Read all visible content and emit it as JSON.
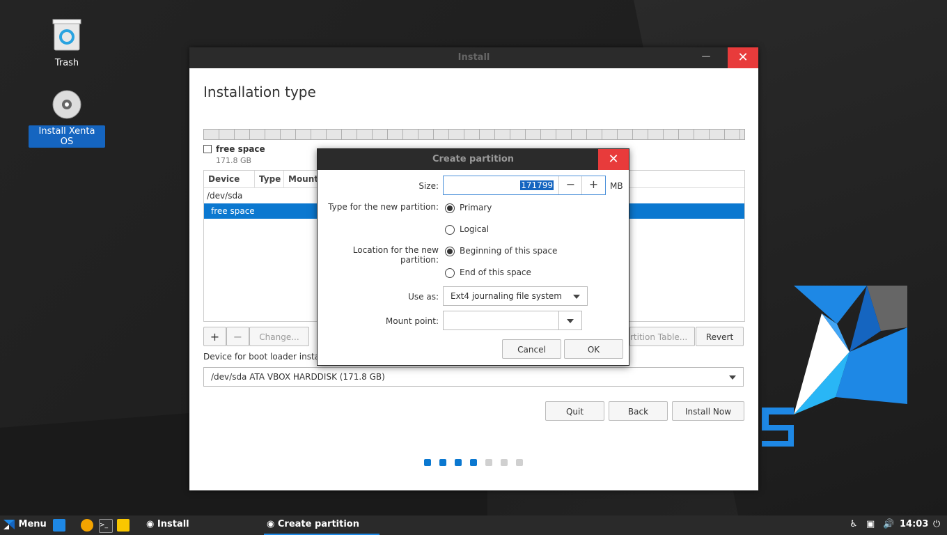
{
  "desktop": {
    "icons": [
      {
        "label": "Trash"
      },
      {
        "label": "Install Xenta OS"
      }
    ]
  },
  "install_window": {
    "title": "Install",
    "heading": "Installation type",
    "legend": {
      "name": "free space",
      "size": "171.8 GB"
    },
    "table": {
      "columns": [
        "Device",
        "Type",
        "Mount"
      ],
      "rows": [
        "/dev/sda",
        "free space"
      ]
    },
    "buttons": {
      "add": "+",
      "remove": "−",
      "change": "Change...",
      "new_table": "rtition Table...",
      "revert": "Revert",
      "quit": "Quit",
      "back": "Back",
      "install_now": "Install Now"
    },
    "boot_loader_label": "Device for boot loader installa",
    "boot_loader_device": "/dev/sda  ATA VBOX HARDDISK (171.8 GB)",
    "progress": {
      "total": 7,
      "completed": 4
    }
  },
  "dialog": {
    "title": "Create partition",
    "size_label": "Size:",
    "size_value": "171799",
    "size_unit": "MB",
    "decrement": "−",
    "increment": "+",
    "type_label": "Type for the new partition:",
    "type_options": [
      "Primary",
      "Logical"
    ],
    "type_selected": 0,
    "location_label": "Location for the new partition:",
    "location_options": [
      "Beginning of this space",
      "End of this space"
    ],
    "location_selected": 0,
    "use_as_label": "Use as:",
    "use_as_value": "Ext4 journaling file system",
    "mount_label": "Mount point:",
    "mount_value": "",
    "cancel": "Cancel",
    "ok": "OK"
  },
  "taskbar": {
    "menu_label": "Menu",
    "tasks": [
      "Install",
      "Create partition"
    ],
    "clock": "14:03"
  },
  "colors": {
    "accent": "#0b78d0",
    "close": "#e83b3b",
    "logo_blue": "#1e88e5"
  }
}
